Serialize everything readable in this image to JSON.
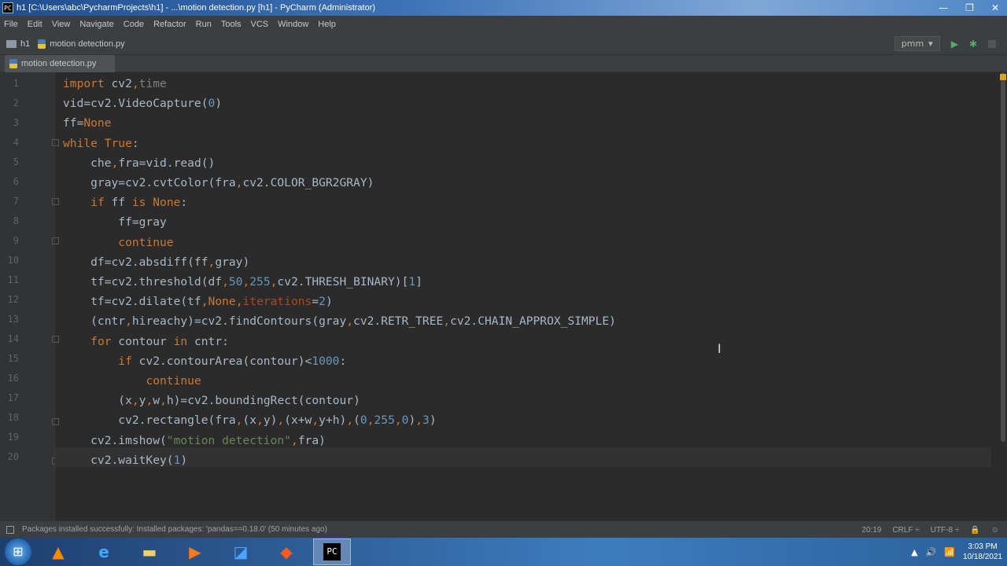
{
  "window": {
    "title": "h1 [C:\\Users\\abc\\PycharmProjects\\h1] - ...\\motion detection.py [h1] - PyCharm (Administrator)",
    "logo_text": "PC",
    "min": "—",
    "max": "❐",
    "close": "✕"
  },
  "menu": [
    "File",
    "Edit",
    "View",
    "Navigate",
    "Code",
    "Refactor",
    "Run",
    "Tools",
    "VCS",
    "Window",
    "Help"
  ],
  "breadcrumb": {
    "project": "h1",
    "file": "motion detection.py"
  },
  "run_config": {
    "label": "pmm",
    "arrow": "▾"
  },
  "tab": {
    "label": "motion detection.py"
  },
  "line_numbers": [
    "1",
    "2",
    "3",
    "4",
    "5",
    "6",
    "7",
    "8",
    "9",
    "10",
    "11",
    "12",
    "13",
    "14",
    "15",
    "16",
    "17",
    "18",
    "19",
    "20"
  ],
  "code": [
    "import cv2,time",
    "vid=cv2.VideoCapture(0)",
    "ff=None",
    "while True:",
    "    che,fra=vid.read()",
    "    gray=cv2.cvtColor(fra,cv2.COLOR_BGR2GRAY)",
    "    if ff is None:",
    "        ff=gray",
    "        continue",
    "    df=cv2.absdiff(ff,gray)",
    "    tf=cv2.threshold(df,50,255,cv2.THRESH_BINARY)[1]",
    "    tf=cv2.dilate(tf,None,iterations=2)",
    "    (cntr,hireachy)=cv2.findContours(gray,cv2.RETR_TREE,cv2.CHAIN_APPROX_SIMPLE)",
    "    for contour in cntr:",
    "        if cv2.contourArea(contour)<1000:",
    "            continue",
    "        (x,y,w,h)=cv2.boundingRect(contour)",
    "        cv2.rectangle(fra,(x,y),(x+w,y+h),(0,255,0),3)",
    "    cv2.imshow(\"motion detection\",fra)",
    "    cv2.waitKey(1)"
  ],
  "status": {
    "message": "Packages installed successfully: Installed packages: 'pandas==0.18.0' (50 minutes ago)",
    "position": "20:19",
    "line_sep": "CRLF ÷",
    "encoding": "UTF-8 ÷"
  },
  "taskbar": {
    "clock_time": "3:03 PM",
    "clock_date": "10/18/2021",
    "pc_label": "PC"
  }
}
